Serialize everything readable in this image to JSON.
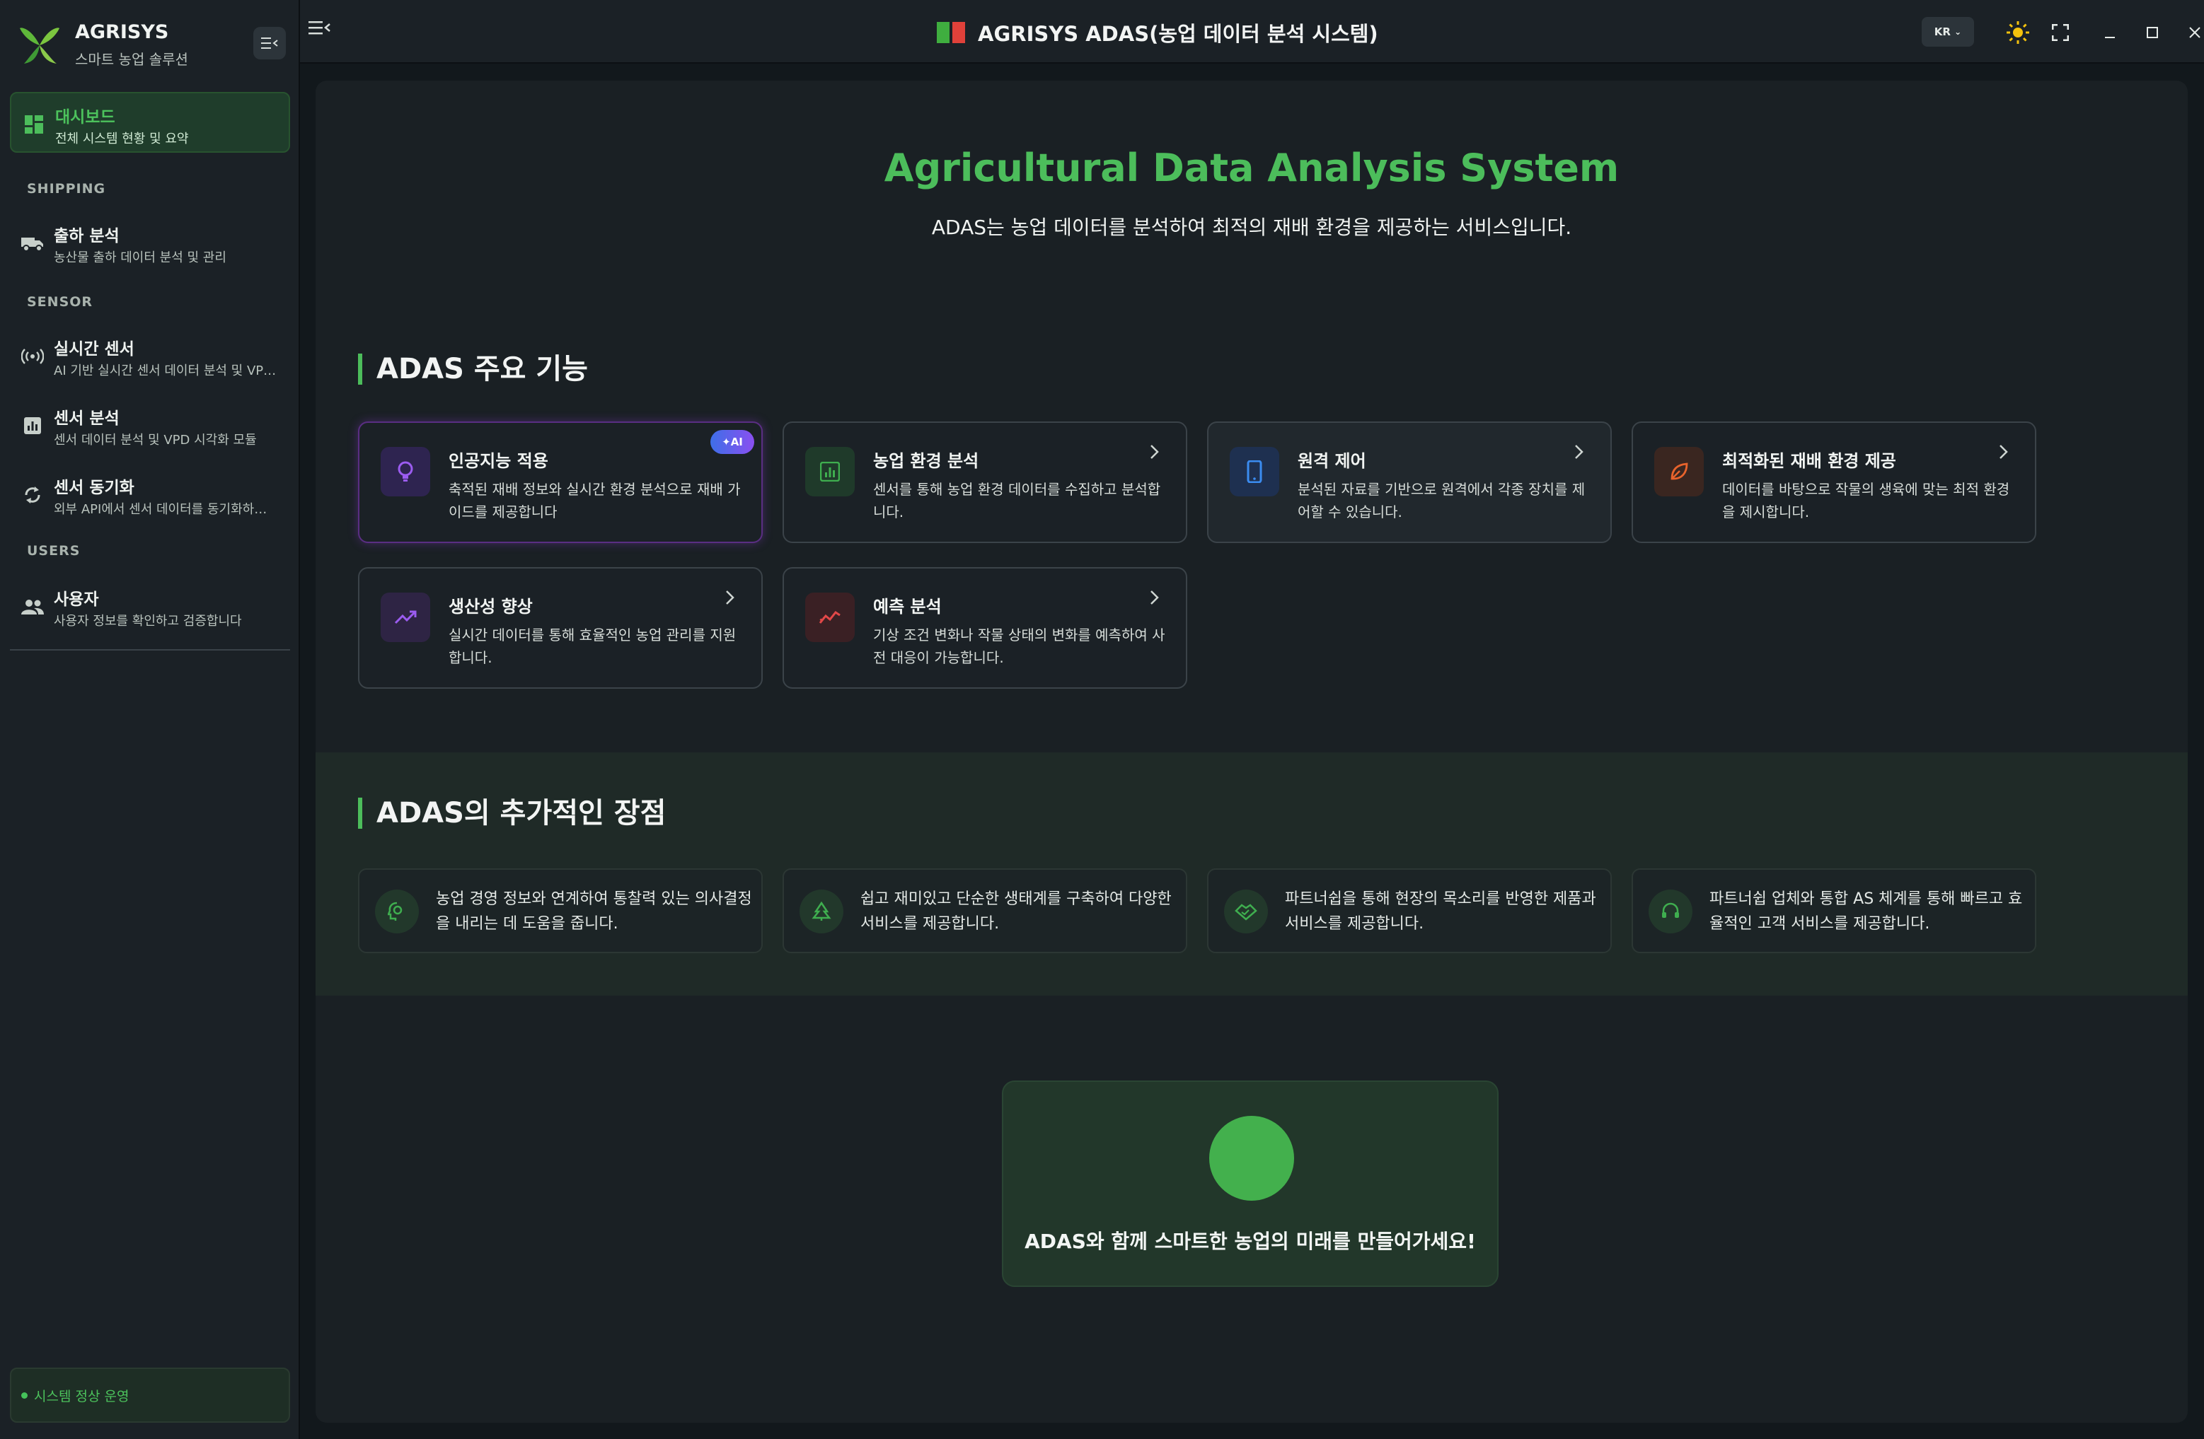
{
  "sidebar": {
    "brand_name": "AGRISYS",
    "brand_sub": "스마트 농업 솔루션",
    "items": [
      {
        "title": "대시보드",
        "desc": "전체 시스템 현황 및 요약"
      },
      {
        "title": "출하 분석",
        "desc": "농산물 출하 데이터 분석 및 관리"
      },
      {
        "title": "실시간 센서",
        "desc": "AI 기반 실시간 센서 데이터 분석 및 VP…"
      },
      {
        "title": "센서 분석",
        "desc": "센서 데이터 분석 및 VPD 시각화 모듈"
      },
      {
        "title": "센서 동기화",
        "desc": "외부 API에서 센서 데이터를 동기화하…"
      },
      {
        "title": "사용자",
        "desc": "사용자 정보를 확인하고 검증합니다"
      }
    ],
    "sections": {
      "shipping": "SHIPPING",
      "sensor": "SENSOR",
      "users": "USERS"
    },
    "status": "시스템 정상 운영"
  },
  "topbar": {
    "title": "AGRISYS ADAS(농업 데이터 분석 시스템)",
    "lang": "KR"
  },
  "hero": {
    "title": "Agricultural Data Analysis System",
    "subtitle": "ADAS는 농업 데이터를 분석하여 최적의 재배 환경을 제공하는 서비스입니다."
  },
  "features": {
    "heading": "ADAS 주요 기능",
    "ai_badge": "AI",
    "cards": [
      {
        "title": "인공지능 적용",
        "desc": "축적된 재배 정보와 실시간 환경 분석으로 재배 가이드를 제공합니다"
      },
      {
        "title": "농업 환경 분석",
        "desc": "센서를 통해 농업 환경 데이터를 수집하고 분석합니다."
      },
      {
        "title": "원격 제어",
        "desc": "분석된 자료를 기반으로 원격에서 각종 장치를 제어할 수 있습니다."
      },
      {
        "title": "최적화된 재배 환경 제공",
        "desc": "데이터를 바탕으로 작물의 생육에 맞는 최적 환경을 제시합니다."
      },
      {
        "title": "생산성 향상",
        "desc": "실시간 데이터를 통해 효율적인 농업 관리를 지원합니다."
      },
      {
        "title": "예측 분석",
        "desc": "기상 조건 변화나 작물 상태의 변화를 예측하여 사전 대응이 가능합니다."
      }
    ]
  },
  "advantages": {
    "heading": "ADAS의 추가적인 장점",
    "items": [
      "농업 경영 정보와 연계하여 통찰력 있는 의사결정을 내리는 데 도움을 줍니다.",
      "쉽고 재미있고 단순한 생태계를 구축하여 다양한 서비스를 제공합니다.",
      "파트너쉽을 통해 현장의 목소리를 반영한 제품과 서비스를 제공합니다.",
      "파트너쉽 업체와 통합 AS 체계를 통해 빠르고 효율적인 고객 서비스를 제공합니다."
    ]
  },
  "cta": {
    "text": "ADAS와 함께 스마트한 농업의 미래를 만들어가세요!"
  },
  "colors": {
    "accent": "#4cbd5b",
    "background": "#12181c",
    "panel": "#1a2024"
  }
}
